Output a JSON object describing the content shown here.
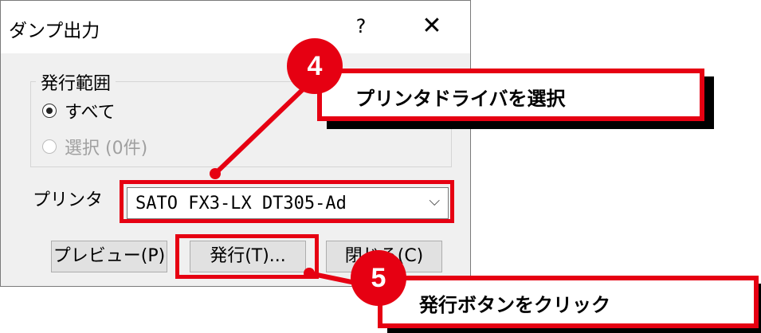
{
  "dialog": {
    "title": "ダンプ出力",
    "help_label": "?",
    "close_label": "✕",
    "group": {
      "label": "発行範囲",
      "options": [
        {
          "label": "すべて",
          "checked": true,
          "disabled": false
        },
        {
          "label": "選択 (0件)",
          "checked": false,
          "disabled": true
        }
      ]
    },
    "printer": {
      "label": "プリンタ",
      "value": "SATO FX3-LX DT305-Ad",
      "chevron": "⌵"
    },
    "buttons": {
      "preview": "プレビュー(P)",
      "issue": "発行(T)...",
      "close": "閉じる(C)"
    }
  },
  "annotations": {
    "step4": {
      "number": "4",
      "text": "プリンタドライバを選択"
    },
    "step5": {
      "number": "5",
      "text": "発行ボタンをクリック"
    },
    "accent_color": "#e60012"
  }
}
